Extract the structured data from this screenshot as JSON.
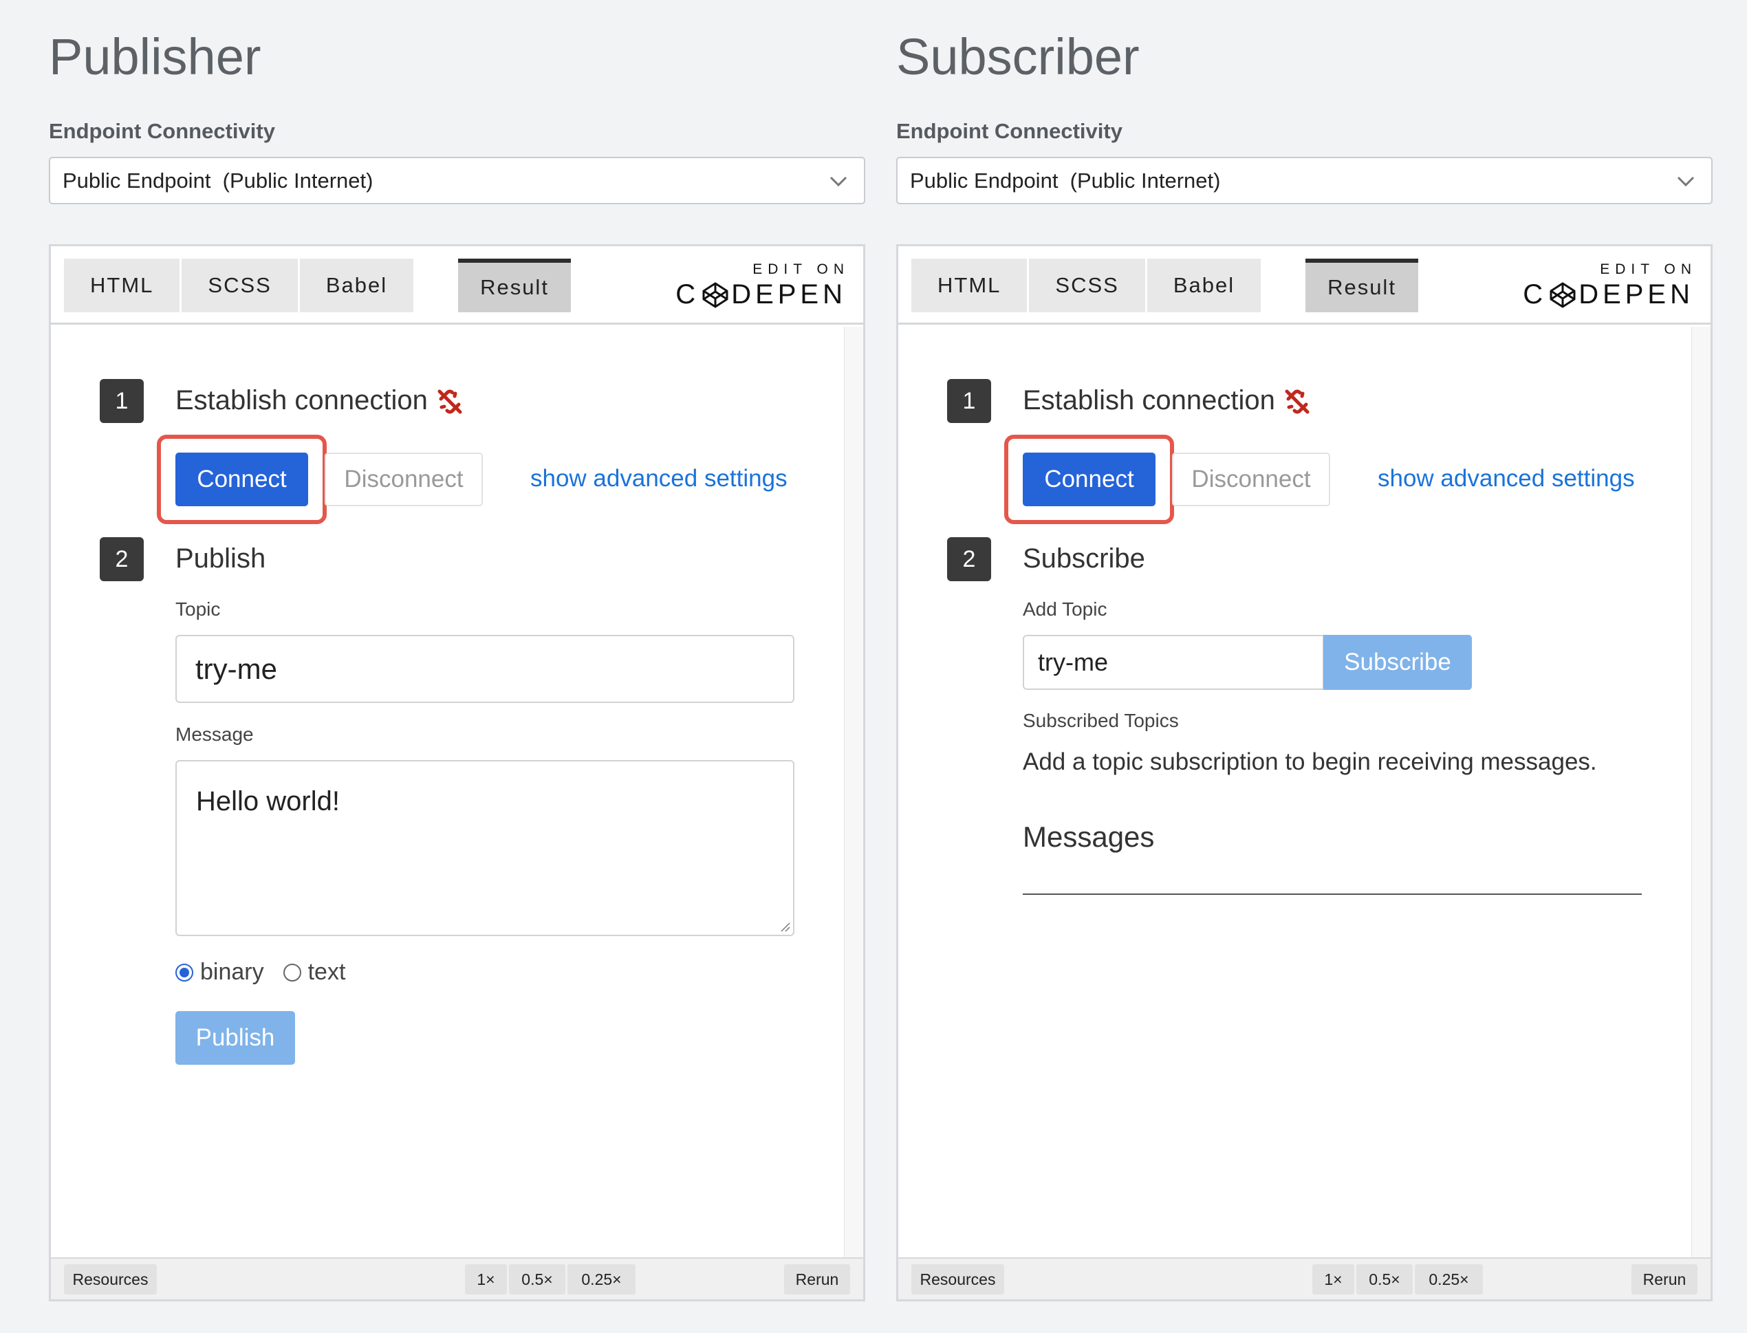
{
  "publisher": {
    "title": "Publisher",
    "endpoint_label": "Endpoint Connectivity",
    "endpoint_value": "Public Endpoint  (Public Internet)",
    "pen": {
      "tabs": [
        "HTML",
        "SCSS",
        "Babel"
      ],
      "result_tab": "Result",
      "edit_on": "EDIT ON",
      "codepen_left": "C",
      "codepen_right": "DEPEN",
      "step1_num": "1",
      "step1_title": "Establish connection",
      "connect_label": "Connect",
      "disconnect_label": "Disconnect",
      "advanced_link": "show advanced settings",
      "step2_num": "2",
      "step2_title": "Publish",
      "topic_label": "Topic",
      "topic_value": "try-me",
      "message_label": "Message",
      "message_value": "Hello world!",
      "radio_binary": "binary",
      "radio_text": "text",
      "radio_selected": "binary",
      "publish_label": "Publish",
      "footer": {
        "resources": "Resources",
        "zoom": [
          "1×",
          "0.5×",
          "0.25×"
        ],
        "rerun": "Rerun"
      }
    }
  },
  "subscriber": {
    "title": "Subscriber",
    "endpoint_label": "Endpoint Connectivity",
    "endpoint_value": "Public Endpoint  (Public Internet)",
    "pen": {
      "tabs": [
        "HTML",
        "SCSS",
        "Babel"
      ],
      "result_tab": "Result",
      "edit_on": "EDIT ON",
      "codepen_left": "C",
      "codepen_right": "DEPEN",
      "step1_num": "1",
      "step1_title": "Establish connection",
      "connect_label": "Connect",
      "disconnect_label": "Disconnect",
      "advanced_link": "show advanced settings",
      "step2_num": "2",
      "step2_title": "Subscribe",
      "add_topic_label": "Add Topic",
      "topic_value": "try-me",
      "subscribe_label": "Subscribe",
      "subscribed_topics_label": "Subscribed Topics",
      "empty_text": "Add a topic subscription to begin receiving messages.",
      "messages_heading": "Messages",
      "footer": {
        "resources": "Resources",
        "zoom": [
          "1×",
          "0.5×",
          "0.25×"
        ],
        "rerun": "Rerun"
      }
    }
  },
  "colors": {
    "primary": "#2563d8",
    "primary_disabled": "#7fb3ea",
    "highlight": "#e5564b",
    "link": "#1a73d9",
    "unlink_icon": "#c0281d"
  }
}
